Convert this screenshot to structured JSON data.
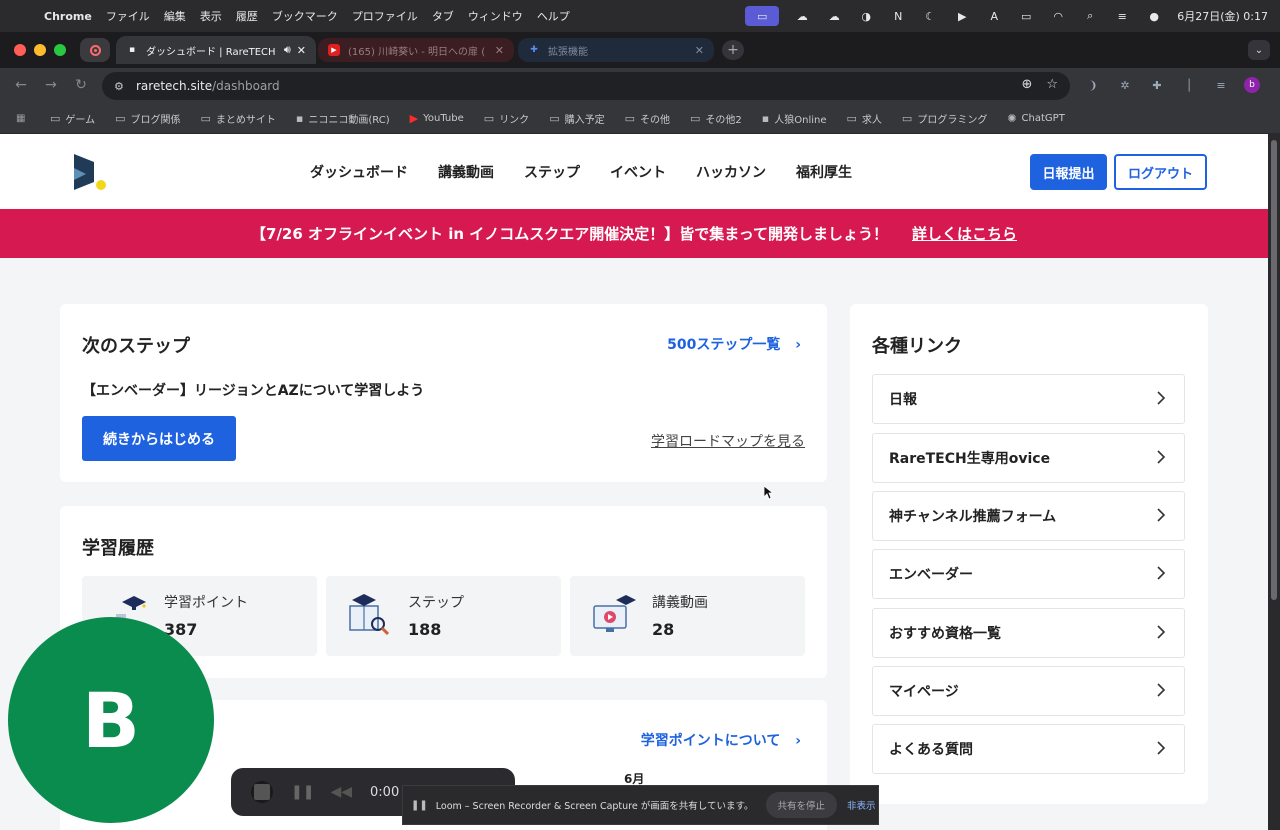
{
  "menubar": {
    "app": "Chrome",
    "items": [
      "ファイル",
      "編集",
      "表示",
      "履歴",
      "ブックマーク",
      "プロファイル",
      "タブ",
      "ウィンドウ",
      "ヘルプ"
    ],
    "clock": "6月27日(金)  0:17"
  },
  "tabs": [
    {
      "title": "ダッシュボード | RareTECH",
      "active": true
    },
    {
      "title": "(165) 川崎葵い - 明日への扉 (",
      "active": false
    },
    {
      "title": "拡張機能",
      "active": false
    }
  ],
  "omnibox": {
    "host": "raretech.site",
    "path": "/dashboard"
  },
  "bookmarks": [
    "ゲーム",
    "ブログ関係",
    "まとめサイト",
    "ニコニコ動画(RC)",
    "YouTube",
    "リンク",
    "購入予定",
    "その他",
    "その他2",
    "人狼Online",
    "求人",
    "プログラミング",
    "ChatGPT"
  ],
  "site": {
    "nav": [
      "ダッシュボード",
      "講義動画",
      "ステップ",
      "イベント",
      "ハッカソン",
      "福利厚生"
    ],
    "report_button": "日報提出",
    "logout_button": "ログアウト",
    "banner_text": "【7/26 オフラインイベント in イノコムスクエア開催決定！】皆で集まって開発しましょう！",
    "banner_link": "詳しくはこちら",
    "accent": "#1e62e0",
    "banner_color": "#d61950"
  },
  "next_step": {
    "title": "次のステップ",
    "all_link": "500ステップ一覧",
    "step_name": "【エンベーダー】リージョンとAZについて学習しよう",
    "continue_button": "続きからはじめる",
    "roadmap_link": "学習ロードマップを見る"
  },
  "history": {
    "title": "学習履歴",
    "stats": [
      {
        "label": "学習ポイント",
        "value": "387",
        "icon": "graduation-stairs-icon"
      },
      {
        "label": "ステップ",
        "value": "188",
        "icon": "book-magnifier-icon"
      },
      {
        "label": "講義動画",
        "value": "28",
        "icon": "video-monitor-icon"
      }
    ]
  },
  "points": {
    "about_link": "学習ポイントについて",
    "month": "6月"
  },
  "links": {
    "title": "各種リンク",
    "items": [
      "日報",
      "RareTECH生専用ovice",
      "神チャンネル推薦フォーム",
      "エンベーダー",
      "おすすめ資格一覧",
      "マイページ",
      "よくある質問"
    ]
  },
  "loom": {
    "time": "0:00",
    "avatar_letter": "B",
    "share_message": "Loom – Screen Recorder & Screen Capture が画面を共有しています。",
    "stop_share": "共有を停止",
    "hide": "非表示"
  }
}
